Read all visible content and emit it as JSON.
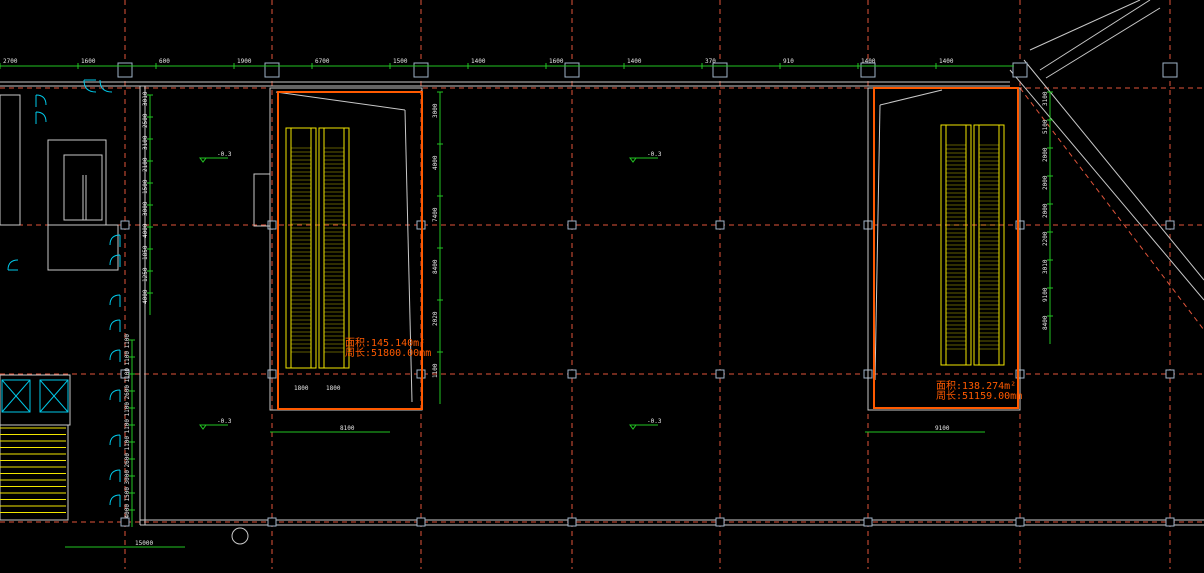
{
  "drawing": {
    "colors": {
      "background": "#000000",
      "grid": "#e0543a",
      "dimension": "#22c422",
      "wall": "#c8c8c8",
      "escalator": "#f2e600",
      "door": "#00c8e8",
      "boundary": "#ff5a00",
      "column": "#9fb3c8"
    },
    "dimensions_top": [
      "2700",
      "1600",
      "600",
      "1900",
      "6700",
      "1500",
      "1400",
      "1600",
      "1400",
      "370",
      "910",
      "1400",
      "1400"
    ],
    "dimensions_left": [
      "3010",
      "2500",
      "3100",
      "2100",
      "1500",
      "3000",
      "4000",
      "1850",
      "1250",
      "4000",
      "1100",
      "1100",
      "1100",
      "2600",
      "1100",
      "1100",
      "1100",
      "2600",
      "3000",
      "1500",
      "4000"
    ],
    "dimensions_right": [
      "3000",
      "4000",
      "7400",
      "8400",
      "2020",
      "1100",
      "3100",
      "5100",
      "2000",
      "2000",
      "2000",
      "2200",
      "3010",
      "9100",
      "8400"
    ],
    "dimensions_bottom": [
      "8100",
      "9100",
      "15000"
    ],
    "levels": [
      "-0.3",
      "-0.3",
      "-0.3",
      "-0.3",
      "-0.3",
      "-0.3"
    ],
    "escalator_labels": [
      "1800",
      "1800"
    ],
    "area_left": [
      "面积:145.140m²",
      "周长:51800.00mm"
    ],
    "area_right": [
      "面积:138.274m²",
      "周长:51159.00mm"
    ]
  }
}
